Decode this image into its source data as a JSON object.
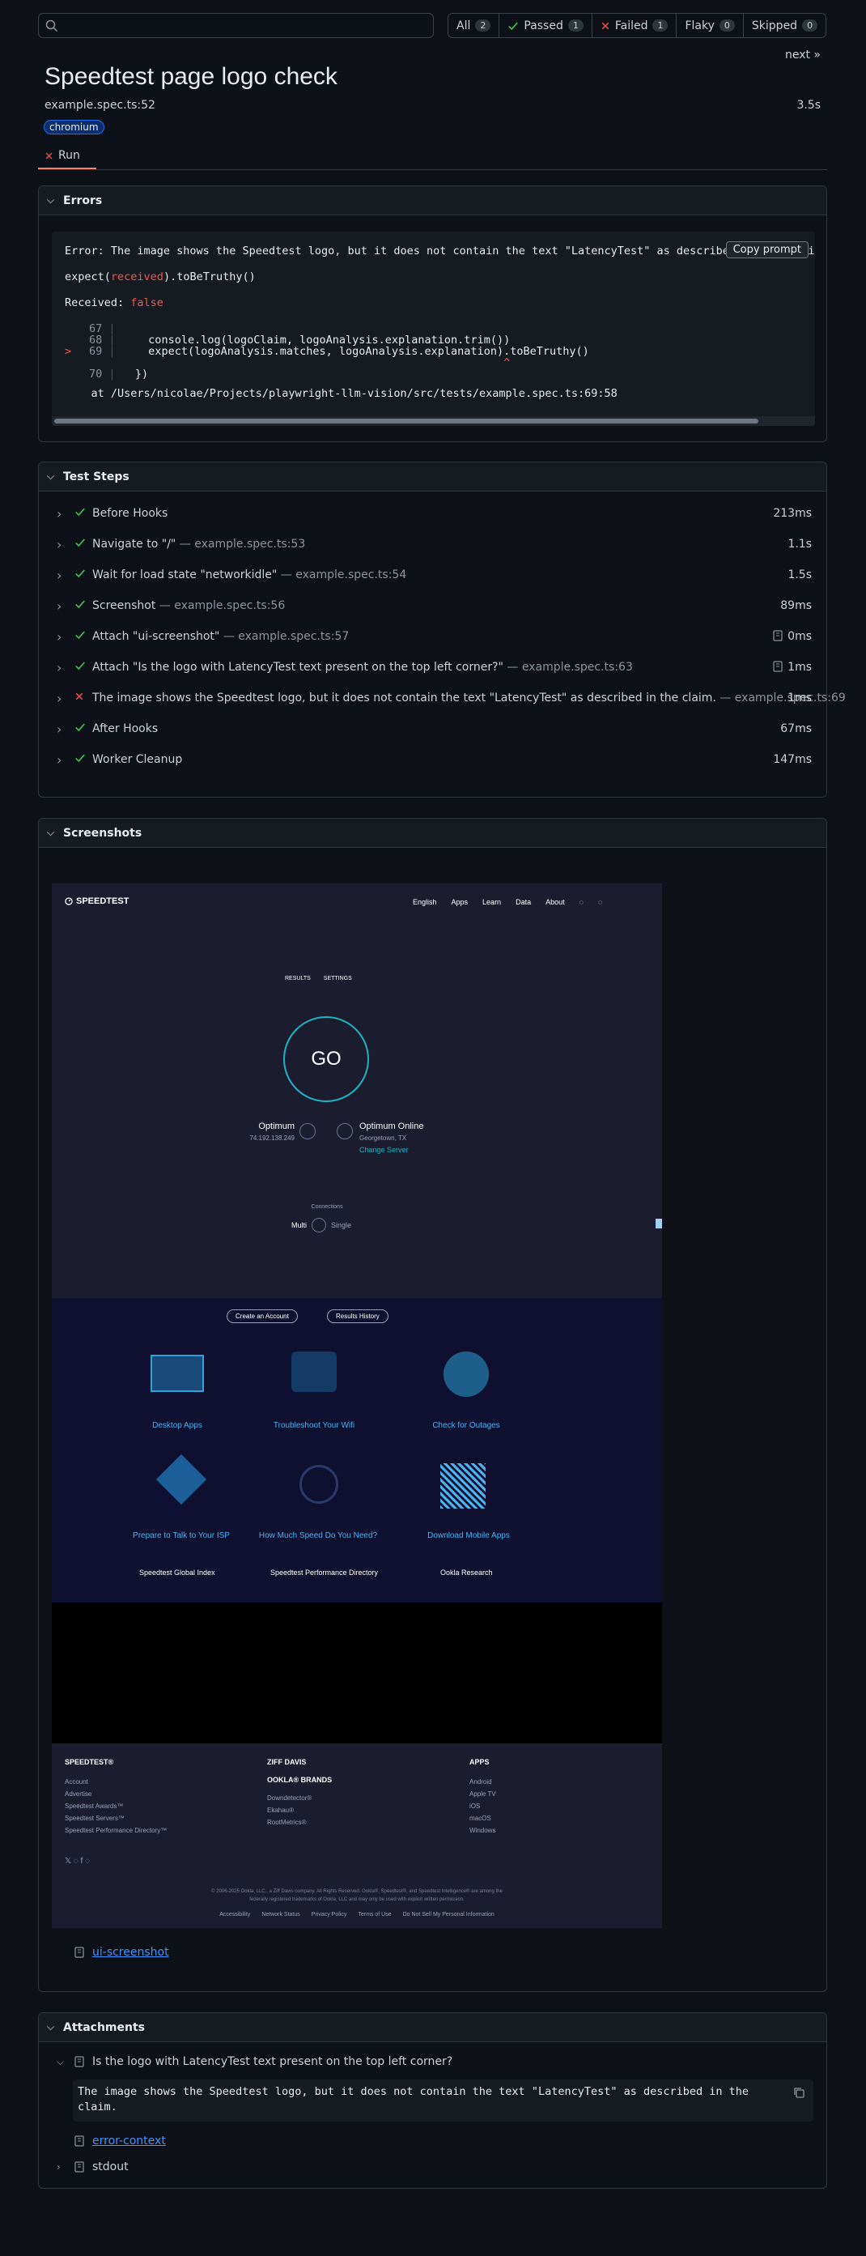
{
  "filters": [
    {
      "label": "All",
      "count": "2"
    },
    {
      "label": "Passed",
      "count": "1"
    },
    {
      "label": "Failed",
      "count": "1"
    },
    {
      "label": "Flaky",
      "count": "0"
    },
    {
      "label": "Skipped",
      "count": "0"
    }
  ],
  "search": {
    "placeholder": ""
  },
  "nav": {
    "next": "next »"
  },
  "test": {
    "title": "Speedtest page logo check",
    "file": "example.spec.ts:52",
    "duration": "3.5s",
    "project": "chromium",
    "run_tab": "Run"
  },
  "errors": {
    "heading": "Errors",
    "line1": "Error: The image shows the Speedtest logo, but it does not contain the text \"LatencyTest\" as described in the claim.",
    "expect_prefix": "expect(",
    "expect_received": "received",
    "expect_suffix": ").toBeTruthy()",
    "received_label": "Received: ",
    "received_value": "false",
    "code": [
      {
        "marker": " ",
        "num": "67",
        "text": ""
      },
      {
        "marker": " ",
        "num": "68",
        "text": "    console.log(logoClaim, logoAnalysis.explanation.trim())"
      },
      {
        "marker": ">",
        "num": "69",
        "text": "    expect(logoAnalysis.matches, logoAnalysis.explanation).toBeTruthy()"
      },
      {
        "marker": " ",
        "num": "",
        "text": "                                                          ^"
      },
      {
        "marker": " ",
        "num": "70",
        "text": "  })"
      }
    ],
    "stack": "    at /Users/nicolae/Projects/playwright-llm-vision/src/tests/example.spec.ts:69:58",
    "copy_prompt": "Copy prompt"
  },
  "steps": {
    "heading": "Test Steps",
    "items": [
      {
        "title": "Before Hooks",
        "loc": "",
        "duration": "213ms",
        "status": "passed",
        "attachment": false
      },
      {
        "title": "Navigate to \"/\"",
        "loc": " — example.spec.ts:53",
        "duration": "1.1s",
        "status": "passed",
        "attachment": false
      },
      {
        "title": "Wait for load state \"networkidle\"",
        "loc": " — example.spec.ts:54",
        "duration": "1.5s",
        "status": "passed",
        "attachment": false
      },
      {
        "title": "Screenshot",
        "loc": " — example.spec.ts:56",
        "duration": "89ms",
        "status": "passed",
        "attachment": false
      },
      {
        "title": "Attach \"ui-screenshot\"",
        "loc": " — example.spec.ts:57",
        "duration": "0ms",
        "status": "passed",
        "attachment": true
      },
      {
        "title": "Attach \"Is the logo with LatencyTest text present on the top left corner?\"",
        "loc": " — example.spec.ts:63",
        "duration": "1ms",
        "status": "passed",
        "attachment": true
      },
      {
        "title": "The image shows the Speedtest logo, but it does not contain the text \"LatencyTest\" as described in the claim.",
        "loc": " — example.spec.ts:69",
        "duration": "1ms",
        "status": "failed",
        "attachment": false
      },
      {
        "title": "After Hooks",
        "loc": "",
        "duration": "67ms",
        "status": "passed",
        "attachment": false
      },
      {
        "title": "Worker Cleanup",
        "loc": "",
        "duration": "147ms",
        "status": "passed",
        "attachment": false
      }
    ]
  },
  "screenshots": {
    "heading": "Screenshots",
    "link": "ui-screenshot",
    "speedtest": {
      "logo": "SPEEDTEST",
      "nav": [
        "English",
        "Apps",
        "Learn",
        "Data",
        "About"
      ],
      "results": "RESULTS",
      "settings": "SETTINGS",
      "go": "GO",
      "isp_name": "Optimum",
      "isp_ip": "74.192.138.249",
      "server_name": "Optimum Online",
      "server_loc": "Georgetown, TX",
      "change_server": "Change Server",
      "connections": "Connections",
      "multi": "Multi",
      "single": "Single",
      "create_account": "Create an Account",
      "results_history": "Results History",
      "tiles": [
        "Desktop Apps",
        "Troubleshoot Your Wifi",
        "Check for Outages",
        "Prepare to Talk to Your ISP",
        "How Much Speed Do You Need?",
        "Download Mobile Apps"
      ],
      "links": [
        "Speedtest Global Index",
        "Speedtest Performance Directory",
        "Ookla Research"
      ],
      "footer": {
        "col1_title": "SPEEDTEST®",
        "col1": [
          "Account",
          "Advertise",
          "Speedtest Awards™",
          "Speedtest Servers™",
          "Speedtest Performance Directory™"
        ],
        "col2_title": "ZIFF DAVIS",
        "col2_sub": "OOKLA® BRANDS",
        "col2": [
          "Downdetector®",
          "Ekahau®",
          "RootMetrics®"
        ],
        "col3_title": "APPS",
        "col3": [
          "Android",
          "Apple TV",
          "iOS",
          "macOS",
          "Windows"
        ],
        "legal1": "© 2006-2025 Ookla, LLC., a Ziff Davis company. All Rights Reserved. Ookla®, Speedtest®, and Speedtest Intelligence® are among the",
        "legal2": "federally registered trademarks of Ookla, LLC and may only be used with explicit written permission.",
        "bottom_links": [
          "Accessibility",
          "Network Status",
          "Privacy Policy",
          "Terms of Use",
          "Do Not Sell My Personal Information"
        ]
      }
    }
  },
  "attachments": {
    "heading": "Attachments",
    "item1_title": "Is the logo with LatencyTest text present on the top left corner?",
    "item1_body": "The image shows the Speedtest logo, but it does not contain the text \"LatencyTest\" as described in the\nclaim.",
    "error_context": "error-context",
    "stdout": "stdout"
  }
}
